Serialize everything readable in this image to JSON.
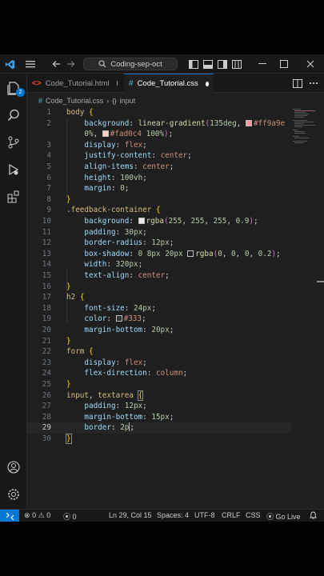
{
  "titlebar": {
    "search_text": "Coding-sep-oct"
  },
  "activity": {
    "source_control_badge": "2"
  },
  "tabs": [
    {
      "label": "Code_Tutorial.html",
      "active": false
    },
    {
      "label": "Code_Tutorial.css",
      "active": true
    }
  ],
  "breadcrumb": {
    "file": "Code_Tutorial.css",
    "symbol": "input"
  },
  "editor": {
    "line_numbers": [
      "1",
      "2",
      "",
      "3",
      "4",
      "5",
      "6",
      "7",
      "8",
      "9",
      "10",
      "11",
      "12",
      "13",
      "14",
      "15",
      "16",
      "17",
      "18",
      "19",
      "20",
      "21",
      "22",
      "23",
      "24",
      "25",
      "26",
      "27",
      "28",
      "29",
      "30"
    ],
    "current_line": "29"
  },
  "statusbar": {
    "errors": "0",
    "warnings": "0",
    "ports": "0",
    "position": "Ln 29, Col 15",
    "spaces": "Spaces: 4",
    "encoding": "UTF-8",
    "eol": "CRLF",
    "language": "CSS",
    "golive": "Go Live"
  },
  "colors": {
    "accent": "#0078d4",
    "gradient_start": "#ff9a9e",
    "gradient_end": "#fad0c4"
  }
}
